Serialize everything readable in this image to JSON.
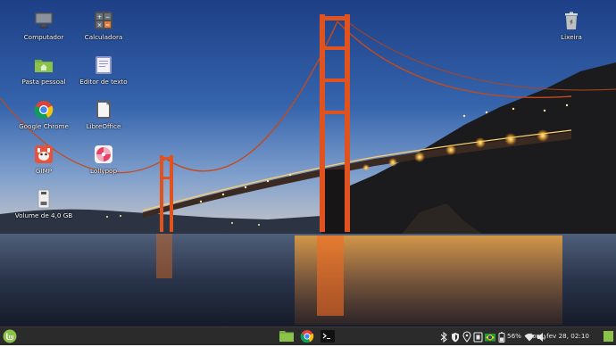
{
  "desktop": {
    "icons": [
      {
        "label": "Computador",
        "icon": "computer-icon"
      },
      {
        "label": "Calculadora",
        "icon": "calculator-icon"
      },
      {
        "label": "Pasta pessoal",
        "icon": "home-folder-icon"
      },
      {
        "label": "Editor de texto",
        "icon": "text-editor-icon"
      },
      {
        "label": "Google Chrome",
        "icon": "chrome-icon"
      },
      {
        "label": "LibreOffice",
        "icon": "libreoffice-icon"
      },
      {
        "label": "GIMP",
        "icon": "gimp-icon"
      },
      {
        "label": "Lollypop",
        "icon": "lollypop-icon"
      },
      {
        "label": "Volume de 4,0 GB",
        "icon": "usb-drive-icon"
      },
      {
        "label": "Lixeira",
        "icon": "trash-icon"
      }
    ]
  },
  "panel": {
    "menu_icon": "linux-mint-menu-icon",
    "launchers": [
      "files-launcher-icon",
      "chrome-launcher-icon",
      "terminal-launcher-icon"
    ],
    "tray_icons": [
      "bluetooth-icon",
      "shield-icon",
      "location-icon",
      "update-icon",
      "brazil-flag-icon",
      "battery-icon",
      "wifi-icon",
      "volume-icon"
    ],
    "battery_percent": "56%",
    "clock": "dom, fev 28, 02:10",
    "show_desktop_icon": "show-desktop-icon"
  },
  "colors": {
    "panel_bg": "#2b2b2b",
    "mint_green": "#8bc34a",
    "bridge_orange": "#e0531f"
  }
}
